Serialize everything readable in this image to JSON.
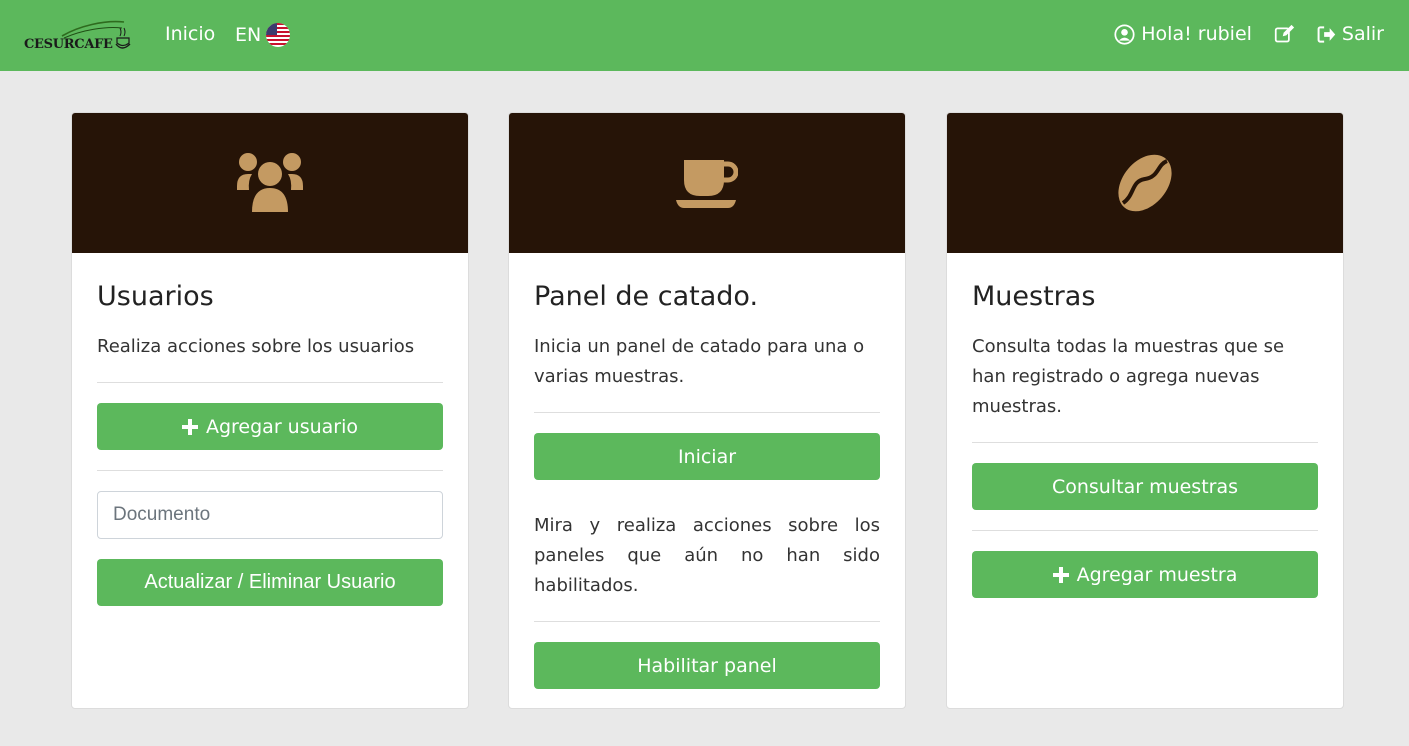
{
  "navbar": {
    "logo_text": "CESURCAFE",
    "home_label": "Inicio",
    "lang_label": "EN",
    "greeting": "Hola! rubiel",
    "logout_label": "Salir"
  },
  "cards": {
    "users": {
      "title": "Usuarios",
      "text": "Realiza acciones sobre los usuarios",
      "add_button": "Agregar usuario",
      "document_placeholder": "Documento",
      "update_button": "Actualizar / Eliminar Usuario",
      "icon": "users-icon"
    },
    "panel": {
      "title": "Panel de catado.",
      "text": "Inicia un panel de catado para una o varias muestras.",
      "start_button": "Iniciar",
      "text2": "Mira y realiza acciones sobre los paneles que aún no han sido habilitados.",
      "enable_button": "Habilitar panel",
      "icon": "coffee-cup-icon"
    },
    "samples": {
      "title": "Muestras",
      "text": "Consulta todas la muestras que se han registrado o agrega nuevas muestras.",
      "consult_button": "Consultar muestras",
      "add_button": "Agregar muestra",
      "icon": "coffee-bean-icon"
    }
  },
  "colors": {
    "navbar": "#5cb85c",
    "card_header": "#261407",
    "icon": "#c49a62",
    "button": "#5cb85c",
    "background": "#e9e9e9"
  }
}
